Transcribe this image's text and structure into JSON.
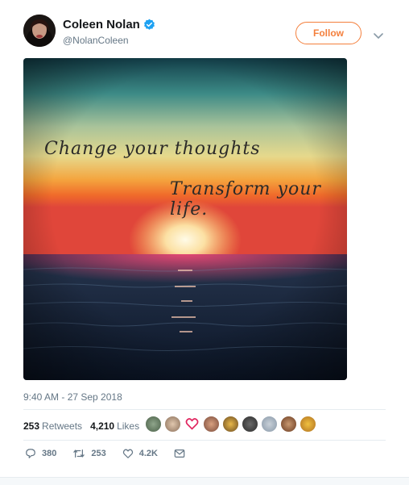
{
  "user": {
    "display_name": "Coleen Nolan",
    "handle": "@NolanColeen",
    "verified": true
  },
  "header": {
    "follow_label": "Follow"
  },
  "media": {
    "quote_line_1": "Change your thoughts",
    "quote_line_2": "Transform your life."
  },
  "tweet": {
    "timestamp": "9:40 AM - 27 Sep 2018"
  },
  "stats": {
    "retweets_count": "253",
    "retweets_label": "Retweets",
    "likes_count": "4,210",
    "likes_label": "Likes"
  },
  "actions": {
    "replies": "380",
    "retweets": "253",
    "likes": "4.2K"
  },
  "colors": {
    "follow_accent": "#f47f3c",
    "verified_blue": "#1da1f2",
    "muted_text": "#657786"
  }
}
